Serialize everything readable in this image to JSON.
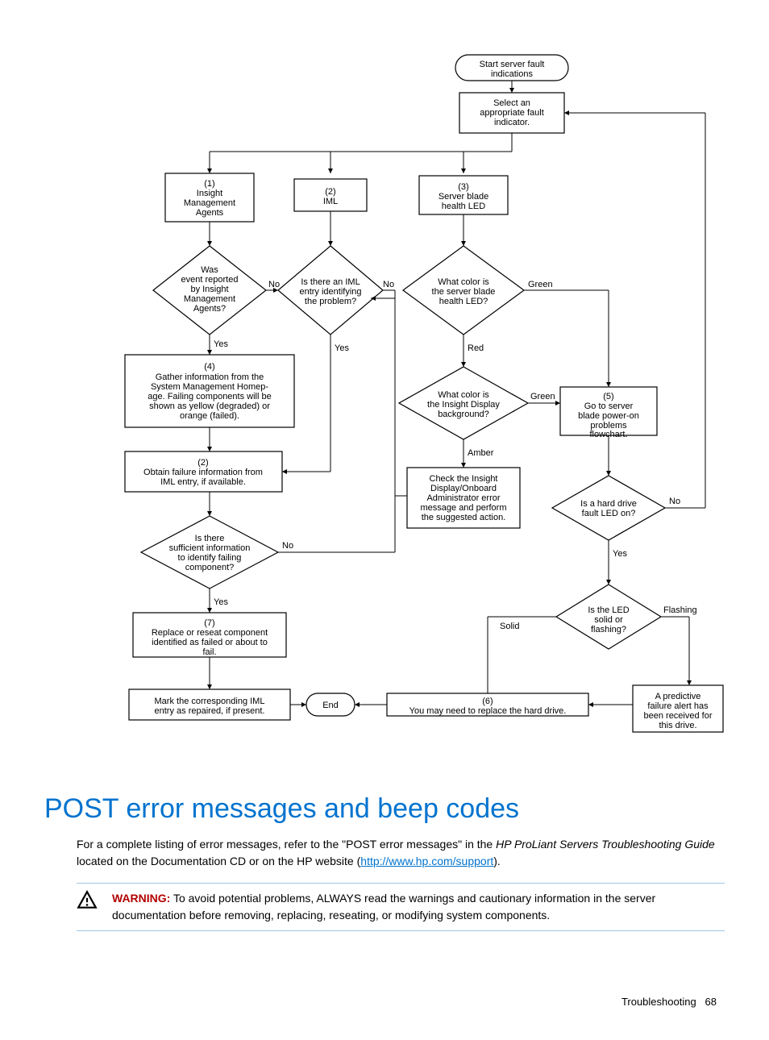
{
  "flow": {
    "start": "Start server fault\nindications",
    "select": "Select an\nappropriate fault\nindicator.",
    "n1": "(1)\nInsight\nManagement\nAgents",
    "n2": "(2)\nIML",
    "n3": "(3)\nServer blade\nhealth LED",
    "d_agents": "Was\nevent reported\nby Insight\nManagement\nAgents?",
    "d_iml": "Is there an IML\nentry identifying\nthe problem?",
    "d_color": "What color is\nthe server blade\nhealth LED?",
    "n4": "(4)\nGather information from the\nSystem Management Homep-\nage. Failing components will be\nshown as yellow (degraded) or\norange (failed).",
    "d_insight": "What color is\nthe Insight Display\nbackground?",
    "n5": "(5)\nGo to server\nblade power-on\nproblems\nflowchart.",
    "n2b": "(2)\nObtain failure information from\nIML entry, if available.",
    "n_check": "Check the Insight\nDisplay/Onboard\nAdministrator error\nmessage and perform\nthe suggested action.",
    "d_hdled": "Is a hard drive\nfault LED on?",
    "d_sufficient": "Is there\nsufficient information\nto identify failing\ncomponent?",
    "d_solid": "Is the LED\nsolid or\nflashing?",
    "n7": "(7)\nReplace or reseat component\nidentified as failed or about to\nfail.",
    "n_mark": "Mark the corresponding IML\nentry as repaired, if present.",
    "n_end": "End",
    "n6": "(6)\nYou may need to replace the hard drive.",
    "n_predict": "A predictive\nfailure alert has\nbeen received for\nthis drive.",
    "lbl_no": "No",
    "lbl_yes": "Yes",
    "lbl_green": "Green",
    "lbl_red": "Red",
    "lbl_amber": "Amber",
    "lbl_solid": "Solid",
    "lbl_flashing": "Flashing"
  },
  "heading": "POST error messages and beep codes",
  "para": {
    "p1a": "For a complete listing of error messages, refer to the \"POST error messages\" in the ",
    "p1b": "HP ProLiant Servers Troubleshooting Guide",
    "p1c": " located on the Documentation CD or on the HP website (",
    "link": "http://www.hp.com/support",
    "p1d": ")."
  },
  "warning": {
    "label": "WARNING:",
    "text": "  To avoid potential problems, ALWAYS read the warnings and cautionary information in the server documentation before removing, replacing, reseating, or modifying system components."
  },
  "footer": {
    "section": "Troubleshooting",
    "page": "68"
  }
}
